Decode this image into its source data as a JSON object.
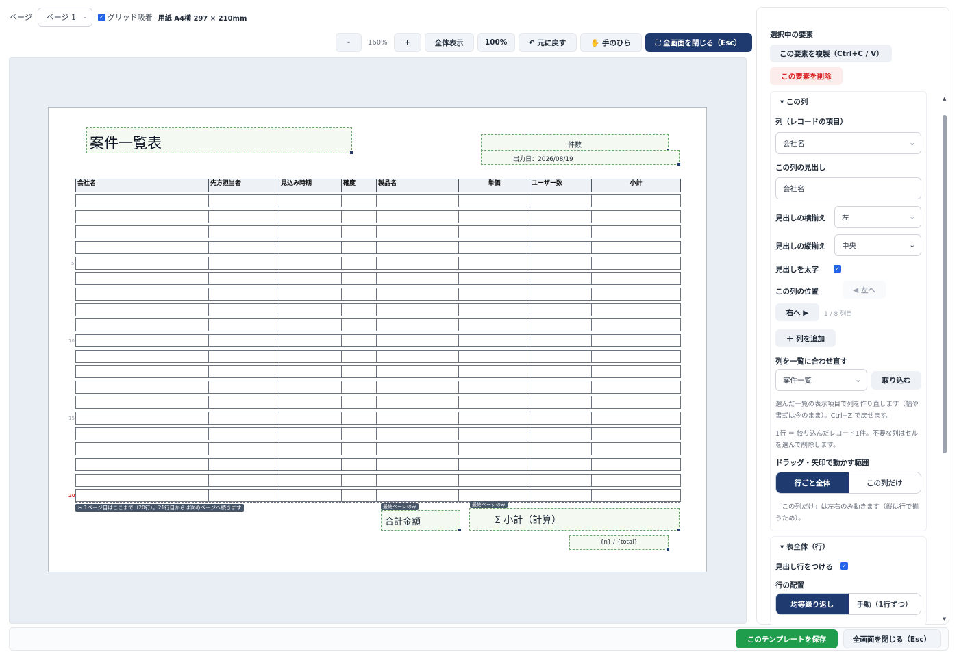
{
  "topbar": {
    "page_label": "ページ",
    "page_select": "ページ 1",
    "grid_snap_label": "グリッド吸着",
    "paper_info": "用紙 A4横 297 × 210mm"
  },
  "toolbar": {
    "zoom_out": "-",
    "zoom_level": "160%",
    "zoom_in": "+",
    "fit_all": "全体表示",
    "actual_size": "100%",
    "undo": "↶ 元に戻す",
    "hand": "✋ 手のひら",
    "exit_fullscreen": "⛶ 全画面を閉じる（Esc）"
  },
  "page": {
    "title": "案件一覧表",
    "count_label": "件数",
    "output_date": "出力日：2026/08/19",
    "columns": [
      "会社名",
      "先方担当者",
      "見込み時期",
      "確度",
      "製品名",
      "単価",
      "ユーザー数",
      "小計"
    ],
    "row_marks": [
      "5",
      "10",
      "15",
      "20"
    ],
    "cut_note": "✂ 1ページ目はここまで（20行）。21行目からは次のページへ続きます",
    "last_page_tag1": "最終ページのみ",
    "last_page_tag2": "最終ページのみ",
    "sum_label": "合計金額",
    "sum_value": "Σ 小計（計算）",
    "page_number": "{n} / {total}"
  },
  "panel": {
    "selected_title": "選択中の要素",
    "duplicate_btn": "この要素を複製（Ctrl+C / V）",
    "delete_btn": "この要素を削除",
    "column_section": "▾ この列",
    "column_field_label": "列（レコードの項目）",
    "column_field_value": "会社名",
    "heading_label": "この列の見出し",
    "heading_value": "会社名",
    "h_align_label": "見出しの横揃え",
    "h_align_value": "左",
    "v_align_label": "見出しの縦揃え",
    "v_align_value": "中央",
    "bold_label": "見出しを太字",
    "position_label": "この列の位置",
    "move_left": "◀ 左へ",
    "move_right": "右へ ▶",
    "position_info": "1 / 8 列目",
    "add_column": "＋ 列を追加",
    "rebuild_label": "列を一覧に合わせ直す",
    "rebuild_select": "案件一覧",
    "import_btn": "取り込む",
    "rebuild_help": "選んだ一覧の表示項目で列を作り直します（幅や書式は今のまま）。Ctrl+Z で戻せます。",
    "row_help": "1行 ＝ 絞り込んだレコード1件。不要な列はセルを選んで削除します。",
    "drag_label": "ドラッグ・矢印で動かす範囲",
    "drag_opt1": "行ごと全体",
    "drag_opt2": "この列だけ",
    "drag_help": "「この列だけ」は左右のみ動きます（縦は行で揃うため）。",
    "table_section": "▾ 表全体（行）",
    "header_row_label": "見出し行をつける",
    "row_layout_label": "行の配置",
    "layout_opt1": "均等繰り返し",
    "layout_opt2": "手動（1行ずつ）"
  },
  "footer": {
    "save": "このテンプレートを保存",
    "close": "全画面を閉じる（Esc）"
  }
}
